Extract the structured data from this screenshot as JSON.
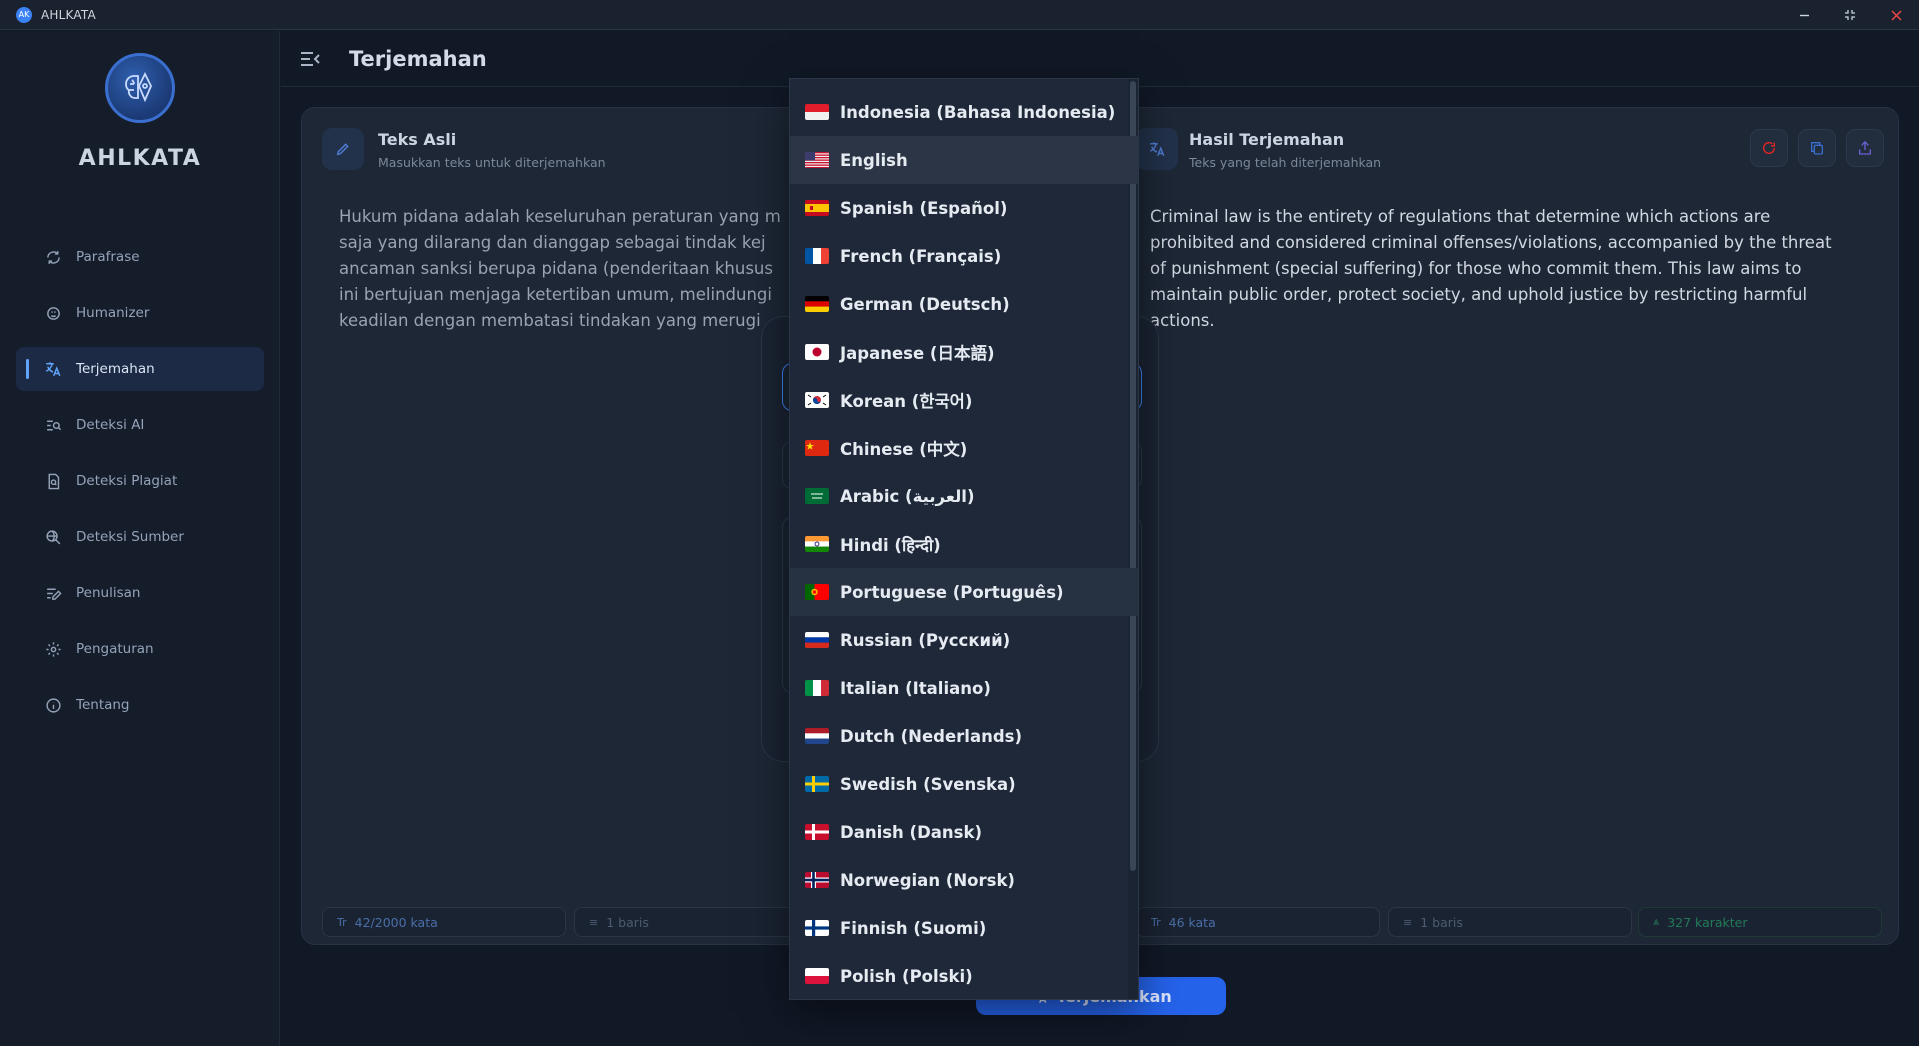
{
  "window": {
    "title": "AHLKATA",
    "icon_label": "AK",
    "controls": [
      "minimize-icon",
      "restore-icon",
      "close-icon"
    ]
  },
  "sidebar": {
    "brand": "AHLKATA",
    "items": [
      {
        "label": "Parafrase",
        "icon": "refresh-icon"
      },
      {
        "label": "Humanizer",
        "icon": "brain-icon"
      },
      {
        "label": "Terjemahan",
        "icon": "translate-icon",
        "active": true
      },
      {
        "label": "Deteksi AI",
        "icon": "ai-detect-icon"
      },
      {
        "label": "Deteksi Plagiat",
        "icon": "plagiarism-icon"
      },
      {
        "label": "Deteksi Sumber",
        "icon": "source-search-icon"
      },
      {
        "label": "Penulisan",
        "icon": "writing-icon"
      },
      {
        "label": "Pengaturan",
        "icon": "gear-icon"
      },
      {
        "label": "Tentang",
        "icon": "info-icon"
      }
    ]
  },
  "header": {
    "title": "Terjemahan"
  },
  "source_pane": {
    "title": "Teks Asli",
    "subtitle": "Masukkan teks untuk diterjemahkan",
    "lines": [
      "Hukum pidana adalah keseluruhan peraturan yang m",
      "saja yang dilarang dan dianggap sebagai tindak kej",
      "ancaman sanksi berupa pidana (penderitaan khusus",
      "ini bertujuan menjaga ketertiban umum, melindungi",
      "keadilan dengan membatasi tindakan yang merugi"
    ],
    "stats": {
      "words": "42/2000 kata",
      "lines": "1 baris"
    }
  },
  "result_pane": {
    "title": "Hasil Terjemahan",
    "subtitle": "Teks yang telah diterjemahkan",
    "lines": [
      "Criminal law is the entirety of regulations that determine which actions are",
      "prohibited and considered criminal offenses/violations, accompanied by the threat",
      "of punishment (special suffering) for those who commit them. This law aims to",
      "maintain public order, protect society, and uphold justice by restricting harmful",
      "actions."
    ],
    "stats": {
      "words": "46 kata",
      "lines": "1 baris",
      "chars": "327 karakter"
    },
    "actions": [
      "refresh-icon",
      "copy-icon",
      "export-icon"
    ]
  },
  "translate_button": {
    "label": "Terjemahkan"
  },
  "language_dropdown": {
    "selected": "English",
    "hovered": "Portuguese (Português)",
    "options": [
      {
        "label": "Indonesia (Bahasa Indonesia)",
        "flag": "id"
      },
      {
        "label": "English",
        "flag": "us"
      },
      {
        "label": "Spanish (Español)",
        "flag": "es"
      },
      {
        "label": "French (Français)",
        "flag": "fr"
      },
      {
        "label": "German (Deutsch)",
        "flag": "de"
      },
      {
        "label": "Japanese (日本語)",
        "flag": "jp"
      },
      {
        "label": "Korean (한국어)",
        "flag": "kr"
      },
      {
        "label": "Chinese (中文)",
        "flag": "cn"
      },
      {
        "label": "Arabic (العربية)",
        "flag": "sa"
      },
      {
        "label": "Hindi (हिन्दी)",
        "flag": "in"
      },
      {
        "label": "Portuguese (Português)",
        "flag": "pt"
      },
      {
        "label": "Russian (Русский)",
        "flag": "ru"
      },
      {
        "label": "Italian (Italiano)",
        "flag": "it"
      },
      {
        "label": "Dutch (Nederlands)",
        "flag": "nl"
      },
      {
        "label": "Swedish (Svenska)",
        "flag": "se"
      },
      {
        "label": "Danish (Dansk)",
        "flag": "dk"
      },
      {
        "label": "Norwegian (Norsk)",
        "flag": "no"
      },
      {
        "label": "Finnish (Suomi)",
        "flag": "fi"
      },
      {
        "label": "Polish (Polski)",
        "flag": "pl"
      }
    ]
  },
  "colors": {
    "accent": "#3b82f6",
    "background": "#111927",
    "card": "#1d2736",
    "success": "#237a58",
    "danger": "#ef4444"
  }
}
